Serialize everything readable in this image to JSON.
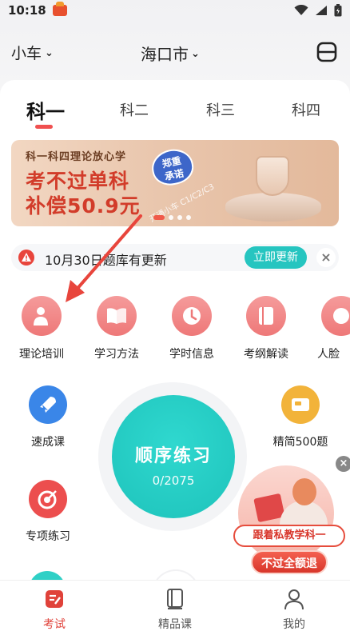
{
  "status_bar": {
    "time": "10:18"
  },
  "header": {
    "vehicle": "小车",
    "city": "海口市"
  },
  "tabs": [
    {
      "label": "科一",
      "active": true
    },
    {
      "label": "科二",
      "active": false
    },
    {
      "label": "科三",
      "active": false
    },
    {
      "label": "科四",
      "active": false
    }
  ],
  "banner": {
    "subtitle": "科一科四理论放心学",
    "line1": "考不过单科",
    "line2": "补偿50.9元",
    "badge": "郑重\n承诺",
    "note": "开通小车 C1/C2/C3"
  },
  "notice": {
    "text": "10月30日题库有更新",
    "button": "立即更新",
    "close": "×"
  },
  "features": [
    {
      "label": "理论培训",
      "icon": "person-teach-icon"
    },
    {
      "label": "学习方法",
      "icon": "book-open-icon"
    },
    {
      "label": "学时信息",
      "icon": "clock-icon"
    },
    {
      "label": "考纲解读",
      "icon": "notebook-icon"
    },
    {
      "label": "人脸",
      "icon": "face-icon"
    }
  ],
  "side": {
    "quick_course": "速成课",
    "special_practice": "专项练习",
    "selected_500": "精简500题"
  },
  "practice": {
    "title": "顺序练习",
    "progress": "0/2075"
  },
  "promo": {
    "tagline": "跟着私教学科一",
    "cta": "不过全额退",
    "close": "×"
  },
  "bottom_nav": [
    {
      "label": "考试",
      "active": true
    },
    {
      "label": "精品课",
      "active": false
    },
    {
      "label": "我的",
      "active": false
    }
  ],
  "colors": {
    "accent_red": "#e0423a",
    "teal": "#1ec3bb"
  }
}
